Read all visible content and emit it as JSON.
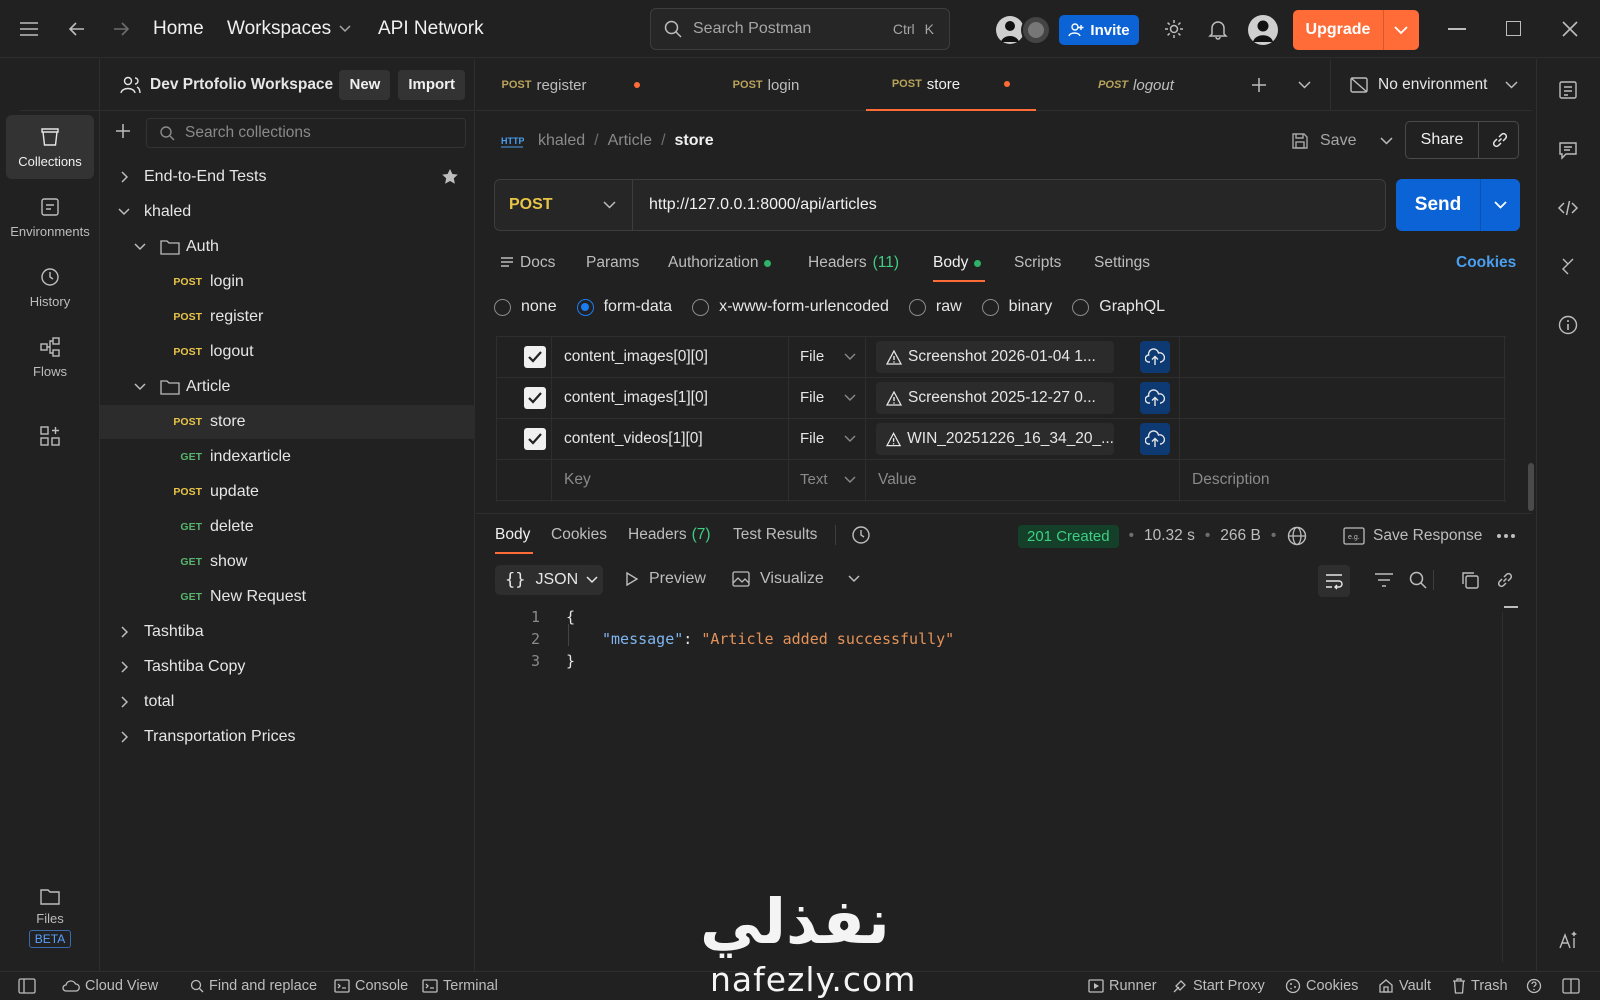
{
  "topbar": {
    "home": "Home",
    "workspaces": "Workspaces",
    "api_network": "API Network",
    "search_placeholder": "Search Postman",
    "shortcut_ctrl": "Ctrl",
    "shortcut_k": "K",
    "invite": "Invite",
    "upgrade": "Upgrade"
  },
  "rail": {
    "items": [
      {
        "label": "Collections",
        "icon": "collections-icon"
      },
      {
        "label": "Environments",
        "icon": "environments-icon"
      },
      {
        "label": "History",
        "icon": "history-icon"
      },
      {
        "label": "Flows",
        "icon": "flows-icon"
      }
    ],
    "files": "Files",
    "beta": "BETA"
  },
  "sidebar": {
    "workspace_name": "Dev Prtofolio Workspace",
    "new_label": "New",
    "import_label": "Import",
    "search_placeholder": "Search collections",
    "tree": [
      {
        "label": "End-to-End Tests",
        "kind": "collection",
        "expanded": false
      },
      {
        "label": "khaled",
        "kind": "collection",
        "expanded": true
      },
      {
        "label": "Auth",
        "kind": "folder",
        "expanded": true
      },
      {
        "label": "login",
        "method": "POST"
      },
      {
        "label": "register",
        "method": "POST"
      },
      {
        "label": "logout",
        "method": "POST"
      },
      {
        "label": "Article",
        "kind": "folder",
        "expanded": true
      },
      {
        "label": "store",
        "method": "POST",
        "selected": true
      },
      {
        "label": "indexarticle",
        "method": "GET"
      },
      {
        "label": "update",
        "method": "POST"
      },
      {
        "label": "delete",
        "method": "GET"
      },
      {
        "label": "show",
        "method": "GET"
      },
      {
        "label": "New Request",
        "method": "GET"
      },
      {
        "label": "Tashtiba",
        "kind": "collection",
        "expanded": false
      },
      {
        "label": "Tashtiba Copy",
        "kind": "collection",
        "expanded": false
      },
      {
        "label": "total",
        "kind": "collection",
        "expanded": false
      },
      {
        "label": "Transportation Prices",
        "kind": "collection",
        "expanded": false
      }
    ]
  },
  "tabs": [
    {
      "method": "POST",
      "name": "register",
      "unsaved": true
    },
    {
      "method": "POST",
      "name": "login",
      "unsaved": false
    },
    {
      "method": "POST",
      "name": "store",
      "unsaved": true,
      "active": true
    },
    {
      "method": "POST",
      "name": "logout",
      "unsaved": false,
      "italic": true
    }
  ],
  "environment": "No environment",
  "breadcrumb": {
    "collection": "khaled",
    "folder": "Article",
    "request": "store",
    "sep": "/"
  },
  "save_label": "Save",
  "share_label": "Share",
  "request": {
    "method": "POST",
    "url": "http://127.0.0.1:8000/api/articles",
    "send": "Send"
  },
  "request_tabs": {
    "docs": "Docs",
    "params": "Params",
    "authorization": "Authorization",
    "headers": "Headers",
    "headers_count": "(11)",
    "body": "Body",
    "scripts": "Scripts",
    "settings": "Settings",
    "cookies": "Cookies"
  },
  "body_types": [
    "none",
    "form-data",
    "x-www-form-urlencoded",
    "raw",
    "binary",
    "GraphQL"
  ],
  "body_type_selected": "form-data",
  "form_rows": [
    {
      "key": "content_images[0][0]",
      "type": "File",
      "value": "Screenshot 2026-01-04 1..."
    },
    {
      "key": "content_images[1][0]",
      "type": "File",
      "value": "Screenshot 2025-12-27 0..."
    },
    {
      "key": "content_videos[1][0]",
      "type": "File",
      "value": "WIN_20251226_16_34_20_..."
    }
  ],
  "form_empty": {
    "key": "Key",
    "type": "Text",
    "value": "Value",
    "description": "Description"
  },
  "response_tabs": {
    "body": "Body",
    "cookies": "Cookies",
    "headers": "Headers",
    "headers_count": "(7)",
    "test_results": "Test Results"
  },
  "response_meta": {
    "status": "201 Created",
    "time": "10.32 s",
    "size": "266 B",
    "save_response": "Save Response"
  },
  "response_view": {
    "format": "JSON",
    "preview": "Preview",
    "visualize": "Visualize"
  },
  "response_code": [
    {
      "n": "1",
      "text": "{"
    },
    {
      "n": "2",
      "key": "\"message\"",
      "colon": ": ",
      "value": "\"Article added successfully\""
    },
    {
      "n": "3",
      "text": "}"
    }
  ],
  "statusbar": {
    "cloud_view": "Cloud View",
    "find_replace": "Find and replace",
    "console": "Console",
    "terminal": "Terminal",
    "runner": "Runner",
    "start_proxy": "Start Proxy",
    "cookies": "Cookies",
    "vault": "Vault",
    "trash": "Trash"
  },
  "watermark": {
    "arabic": "نفذلي",
    "latin": "nafezly.com"
  },
  "colors": {
    "accent": "#ff6c37",
    "primary": "#0b63d6",
    "success": "#3fce84",
    "post": "#e8c548",
    "get": "#59b36c"
  }
}
